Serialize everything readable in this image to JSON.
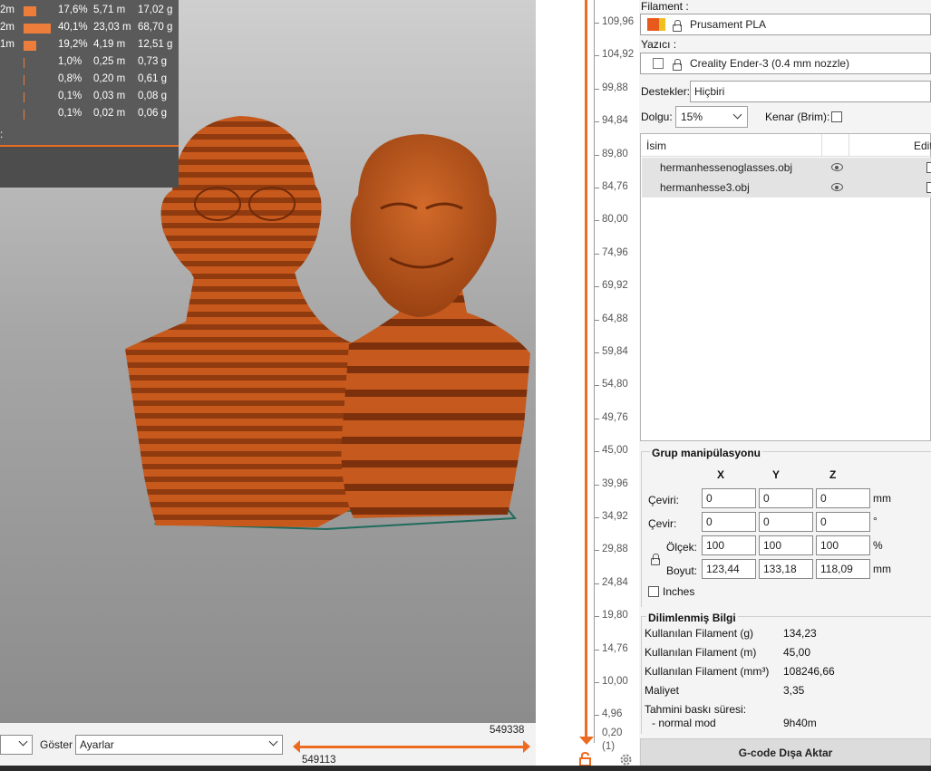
{
  "legend": {
    "rows": [
      {
        "label": "2m",
        "bar": 0.18,
        "percent": "17,6%",
        "length": "5,71 m",
        "weight": "17,02 g"
      },
      {
        "label": "2m",
        "bar": 0.4,
        "percent": "40,1%",
        "length": "23,03 m",
        "weight": "68,70 g"
      },
      {
        "label": "1m",
        "bar": 0.19,
        "percent": "19,2%",
        "length": "4,19 m",
        "weight": "12,51 g"
      },
      {
        "label": "",
        "bar": 0.01,
        "percent": "1,0%",
        "length": "0,25 m",
        "weight": "0,73 g"
      },
      {
        "label": "",
        "bar": 0.008,
        "percent": "0,8%",
        "length": "0,20 m",
        "weight": "0,61 g"
      },
      {
        "label": "",
        "bar": 0.001,
        "percent": "0,1%",
        "length": "0,03 m",
        "weight": "0,08 g"
      },
      {
        "label": "",
        "bar": 0.001,
        "percent": "0,1%",
        "length": "0,02 m",
        "weight": "0,06 g"
      }
    ],
    "trailing": ":"
  },
  "bottombar": {
    "view_select_value": "",
    "show_label": "Göster",
    "show_select_value": "Ayarlar",
    "range_top": "549338",
    "range_bottom": "549113"
  },
  "vslider": {
    "labels": [
      "109,96",
      "104,92",
      "99,88",
      "94,84",
      "89,80",
      "84,76",
      "80,00",
      "74,96",
      "69,92",
      "64,88",
      "59,84",
      "54,80",
      "49,76",
      "45,00",
      "39,96",
      "34,92",
      "29,88",
      "24,84",
      "19,80",
      "14,76",
      "10,00",
      "4,96"
    ],
    "bottom_value": "0,20",
    "bottom_count": "(1)"
  },
  "panel": {
    "filament_label": "Filament :",
    "filament_value": "Prusament PLA",
    "printer_label": "Yazıcı :",
    "printer_value": "Creality Ender-3 (0.4 mm nozzle)",
    "supports_label": "Destekler:",
    "supports_value": "Hiçbiri",
    "infill_label": "Dolgu:",
    "infill_value": "15%",
    "brim_label": "Kenar (Brim):",
    "list_header_name": "İsim",
    "list_header_edit": "Edit",
    "objects": [
      {
        "name": "hermanhessenoglasses.obj"
      },
      {
        "name": "hermanhesse3.obj"
      }
    ],
    "group": {
      "title": "Grup manipülasyonu",
      "col_x": "X",
      "col_y": "Y",
      "col_z": "Z",
      "translate_label": "Çeviri:",
      "translate": [
        "0",
        "0",
        "0"
      ],
      "translate_unit": "mm",
      "rotate_label": "Çevir:",
      "rotate": [
        "0",
        "0",
        "0"
      ],
      "rotate_unit": "°",
      "scale_label": "Ölçek:",
      "scale": [
        "100",
        "100",
        "100"
      ],
      "scale_unit": "%",
      "size_label": "Boyut:",
      "size": [
        "123,44",
        "133,18",
        "118,09"
      ],
      "size_unit": "mm",
      "inches_label": "Inches"
    },
    "sliced": {
      "title": "Dilimlenmiş Bilgi",
      "rows": [
        {
          "label": "Kullanılan Filament (g)",
          "value": "134,23"
        },
        {
          "label": "Kullanılan Filament (m)",
          "value": "45,00"
        },
        {
          "label": "Kullanılan Filament (mm³)",
          "value": "108246,66"
        },
        {
          "label": "Maliyet",
          "value": "3,35"
        }
      ],
      "time_label": "Tahmini baskı süresi:",
      "mode_label": "- normal mod",
      "mode_value": "9h40m"
    },
    "export_button": "G-code Dışa Aktar"
  },
  "colors": {
    "accent": "#ed6b21",
    "model": "#c4561b"
  }
}
